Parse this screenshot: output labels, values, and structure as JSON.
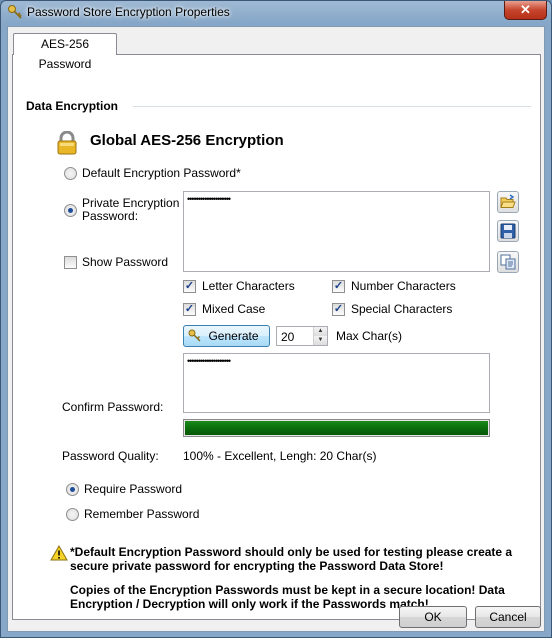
{
  "window": {
    "title": "Password Store Encryption Properties",
    "close_symbol": "✕"
  },
  "tabs": [
    {
      "label": "AES-256 Password",
      "active": true
    }
  ],
  "section": {
    "title": "Data Encryption"
  },
  "header": {
    "title": "Global AES-256 Encryption",
    "icon": "lock-icon"
  },
  "encryption_mode": {
    "default_label": "Default Encryption Password*",
    "default_selected": false,
    "private_label_line1": "Private Encryption",
    "private_label_line2": "Password:",
    "private_selected": true
  },
  "password_field": {
    "value": "••••••••••••••••••••"
  },
  "side_buttons": [
    {
      "name": "open-folder-icon"
    },
    {
      "name": "save-icon"
    },
    {
      "name": "copy-icon"
    }
  ],
  "show_password": {
    "label": "Show Password",
    "checked": false
  },
  "options": {
    "letter": {
      "label": "Letter Characters",
      "checked": true
    },
    "number": {
      "label": "Number Characters",
      "checked": true
    },
    "mixed": {
      "label": "Mixed Case",
      "checked": true
    },
    "special": {
      "label": "Special Characters",
      "checked": true
    }
  },
  "generate": {
    "label": "Generate",
    "length": "20",
    "length_label": "Max Char(s)"
  },
  "confirm": {
    "label": "Confirm Password:",
    "value": "••••••••••••••••••••"
  },
  "quality": {
    "label": "Password Quality:",
    "text": "100% - Excellent, Lengh: 20 Char(s)",
    "percent": 100,
    "color": "#0b6e0b"
  },
  "storage": {
    "require_label": "Require Password",
    "require_selected": true,
    "remember_label": "Remember Password",
    "remember_selected": false
  },
  "notes": {
    "line1": "*Default Encryption Password should only be used for testing please create a",
    "line2": "secure private password for encrypting the Password Data Store!",
    "line3": "Copies of the Encryption Passwords must be kept in a secure location! Data",
    "line4": "Encryption / Decryption will only work if the Passwords match!"
  },
  "footer": {
    "ok_label": "OK",
    "cancel_label": "Cancel"
  }
}
